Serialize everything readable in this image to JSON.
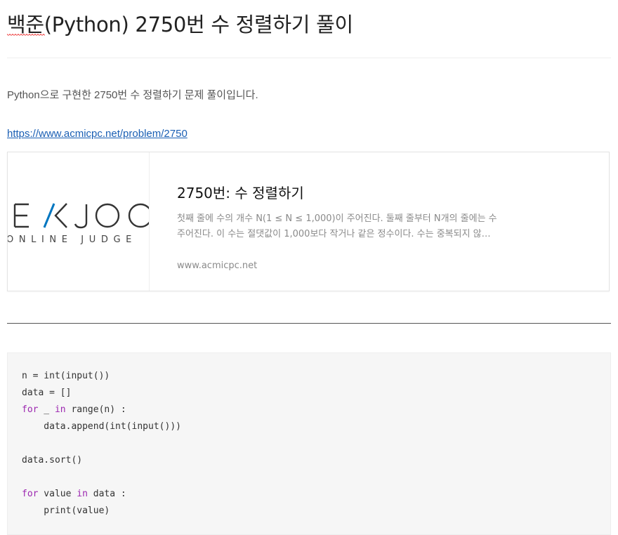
{
  "post": {
    "title": "백준(Python) 2750번 수 정렬하기 풀이",
    "intro": "Python으로 구현한 2750번 수 정렬하기 문제 풀이입니다.",
    "problem_url": "https://www.acmicpc.net/problem/2750"
  },
  "link_card": {
    "logo": {
      "wordmark": "BAEKJOON",
      "visible_wordmark": "EKJOO",
      "tagline": "ONLINE JUDGE",
      "visible_tagline": "ONLINE JUDGE",
      "accent_color": "#0076c0"
    },
    "title": "2750번: 수 정렬하기",
    "description": "첫째 줄에 수의 개수 N(1 ≤ N ≤ 1,000)이 주어진다. 둘째 줄부터 N개의 줄에는 수 주어진다. 이 수는 절댓값이 1,000보다 작거나 같은 정수이다. 수는 중복되지 않…",
    "domain": "www.acmicpc.net"
  },
  "code": {
    "language": "python",
    "lines": [
      [
        {
          "t": "n = int(input())",
          "k": false
        }
      ],
      [
        {
          "t": "data = []",
          "k": false
        }
      ],
      [
        {
          "t": "for",
          "k": true
        },
        {
          "t": " _ ",
          "k": false
        },
        {
          "t": "in",
          "k": true
        },
        {
          "t": " range(n) :",
          "k": false
        }
      ],
      [
        {
          "t": "    data.append(int(input()))",
          "k": false
        }
      ],
      [],
      [
        {
          "t": "data.sort()",
          "k": false
        }
      ],
      [],
      [
        {
          "t": "for",
          "k": true
        },
        {
          "t": " value ",
          "k": false
        },
        {
          "t": "in",
          "k": true
        },
        {
          "t": " data :",
          "k": false
        }
      ],
      [
        {
          "t": "    print(value)",
          "k": false
        }
      ]
    ]
  },
  "colors": {
    "link": "#1a5fb4",
    "keyword": "#9c27b0",
    "code_bg": "#f6f6f6"
  }
}
